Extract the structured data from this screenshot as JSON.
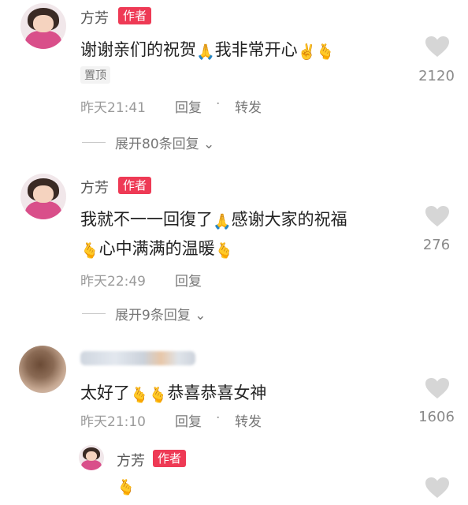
{
  "comments": [
    {
      "username": "方芳",
      "badge": "作者",
      "text": [
        "谢谢亲们的祝贺",
        "我非常开心",
        ""
      ],
      "pin": "置顶",
      "time": "昨天21:41",
      "reply": "回复",
      "dot": "·",
      "forward": "转发",
      "likes": "2120",
      "expand": "展开80条回复"
    },
    {
      "username": "方芳",
      "badge": "作者",
      "line1": [
        "我就不一一回復了",
        "感谢大家的祝福"
      ],
      "line2": [
        "心中满满的温暖"
      ],
      "time": "昨天22:49",
      "reply": "回复",
      "likes": "276",
      "expand": "展开9条回复"
    },
    {
      "text": [
        "太好了",
        "",
        "恭喜恭喜女神"
      ],
      "time": "昨天21:10",
      "reply": "回复",
      "dot": "·",
      "forward": "转发",
      "likes": "1606"
    }
  ],
  "reply": {
    "username": "方芳",
    "badge": "作者"
  },
  "icons": {
    "heart_color": "#d6d6d6",
    "accent": "#ee3a55",
    "emoji_pray": "🙏",
    "emoji_victory": "✌️",
    "emoji_finger_heart": "🫰"
  }
}
